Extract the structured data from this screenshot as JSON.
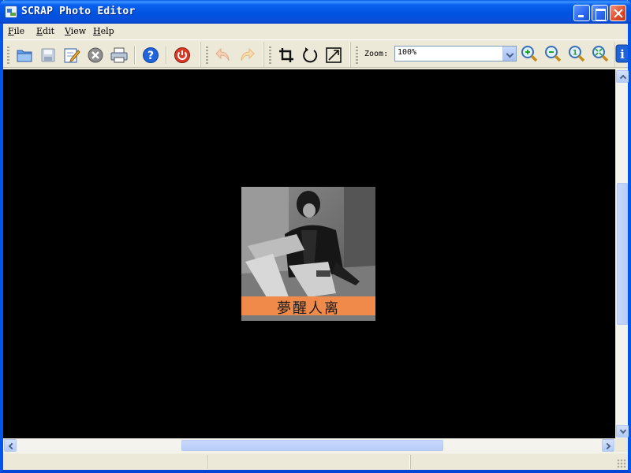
{
  "window": {
    "title": "SCRAP Photo Editor"
  },
  "menu": [
    {
      "label": "File",
      "access": "F",
      "rest": "ile"
    },
    {
      "label": "Edit",
      "access": "E",
      "rest": "dit"
    },
    {
      "label": "View",
      "access": "V",
      "rest": "iew"
    },
    {
      "label": "Help",
      "access": "H",
      "rest": "elp"
    }
  ],
  "toolbar": {
    "zoom_label": "Zoom:",
    "zoom_value": "100%",
    "icons": [
      "open-folder-icon",
      "save-disk-icon",
      "edit-note-icon",
      "close-circle-icon",
      "printer-icon",
      "help-icon",
      "power-icon",
      "undo-icon",
      "redo-icon",
      "crop-icon",
      "rotate-icon",
      "resize-icon",
      "zoom-in-icon",
      "zoom-out-icon",
      "zoom-fit-icon",
      "zoom-actual-icon",
      "info-icon"
    ]
  },
  "image": {
    "caption": "夢醒人离",
    "caption_bg": "#f08a4b",
    "style": "grayscale photo of seated person"
  },
  "colors": {
    "titlebar": "#0052e0",
    "canvas": "#000000",
    "chrome": "#ece9d8"
  }
}
